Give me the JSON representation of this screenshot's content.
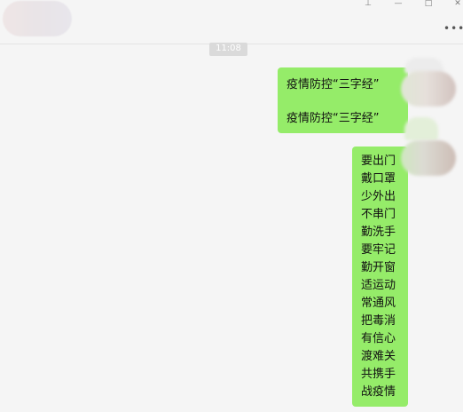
{
  "title_bar": {
    "pin_icon": "pin-icon",
    "minimize_icon": "minimize-icon",
    "maximize_icon": "maximize-icon",
    "close_icon": "close-icon",
    "more_icon": "more-icon",
    "pin_glyph": "⊥",
    "minimize_glyph": "—",
    "maximize_glyph": "□",
    "close_glyph": "✕",
    "more_glyph": "•••"
  },
  "timestamp": "11:08",
  "messages": [
    {
      "sender": "self",
      "lines": [
        "疫情防控“三字经”",
        "疫情防控“三字经”"
      ]
    },
    {
      "sender": "self",
      "lines": [
        "要出门",
        "戴口罩",
        "少外出",
        "不串门",
        "勤洗手",
        "要牢记",
        "勤开窗",
        "适运动",
        "常通风",
        "把毒消",
        "有信心",
        "渡难关",
        "共携手",
        "战疫情"
      ]
    }
  ],
  "colors": {
    "bubble": "#95ec69",
    "background": "#f5f5f5",
    "timestamp_bg": "#dadada"
  }
}
